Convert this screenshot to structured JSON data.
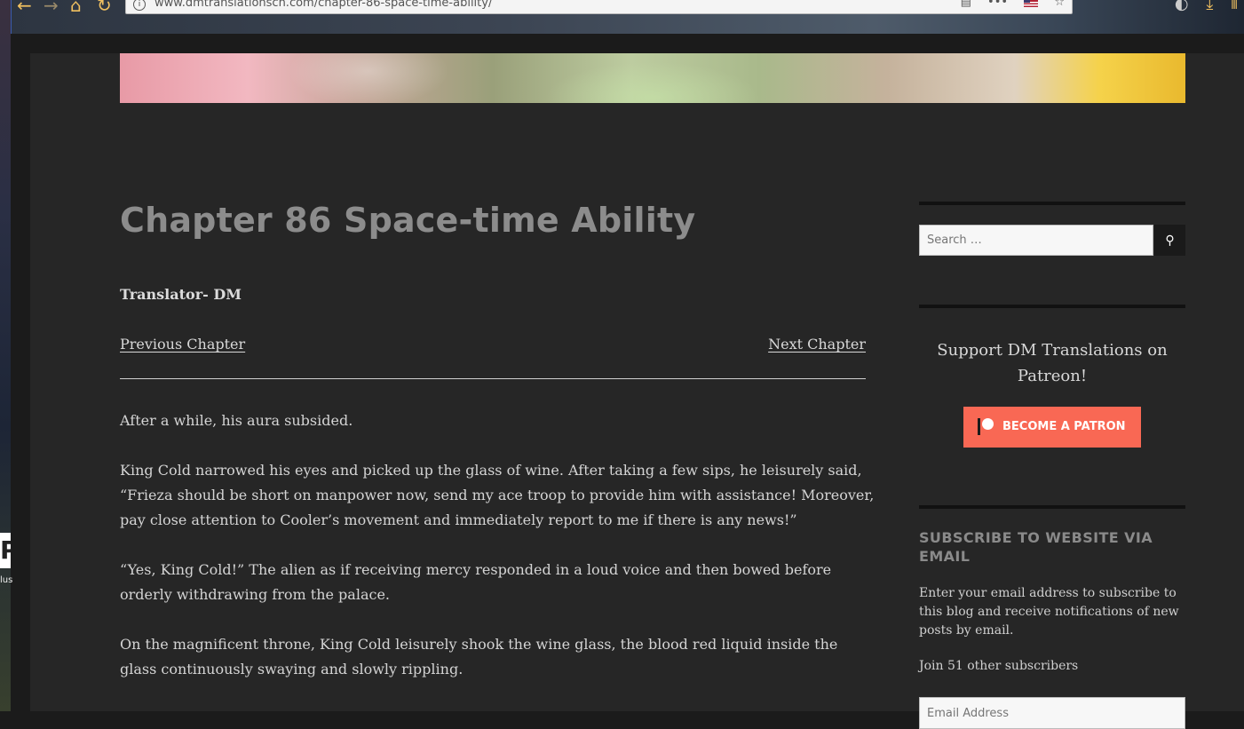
{
  "browser": {
    "url": "www.dmtranslationscn.com/chapter-86-space-time-ability/",
    "info_icon": "i"
  },
  "desktop": {
    "icon_letter": "P",
    "icon_label": "lus"
  },
  "article": {
    "title": "Chapter 86 Space-time Ability",
    "translator": "Translator- DM",
    "prev_label": "Previous Chapter",
    "next_label": "Next Chapter",
    "paragraphs": [
      "After a while, his aura subsided.",
      "King Cold narrowed his eyes and picked up the glass of wine. After taking a few sips, he leisurely said, “Frieza should be short on manpower now, send my ace troop to provide him with assistance! Moreover, pay close attention to Cooler’s movement and immediately report to me if there is any news!”",
      "“Yes, King Cold!”  The alien as if receiving mercy responded in a loud voice and then bowed before orderly withdrawing from the palace.",
      "On the magnificent throne, King Cold leisurely shook the wine glass, the blood red liquid inside the glass continuously swaying and slowly rippling."
    ]
  },
  "sidebar": {
    "search_placeholder": "Search …",
    "patreon_heading": "Support DM Translations on Patreon!",
    "patron_button": "BECOME A PATRON",
    "subscribe_heading": "SUBSCRIBE TO WEBSITE VIA EMAIL",
    "subscribe_desc": "Enter your email address to subscribe to this blog and receive notifications of new posts by email.",
    "subscribers": "Join 51 other subscribers",
    "email_placeholder": "Email Address"
  },
  "colors": {
    "patreon": "#f96854",
    "page_bg": "#262626",
    "title": "#8c8c8c"
  }
}
